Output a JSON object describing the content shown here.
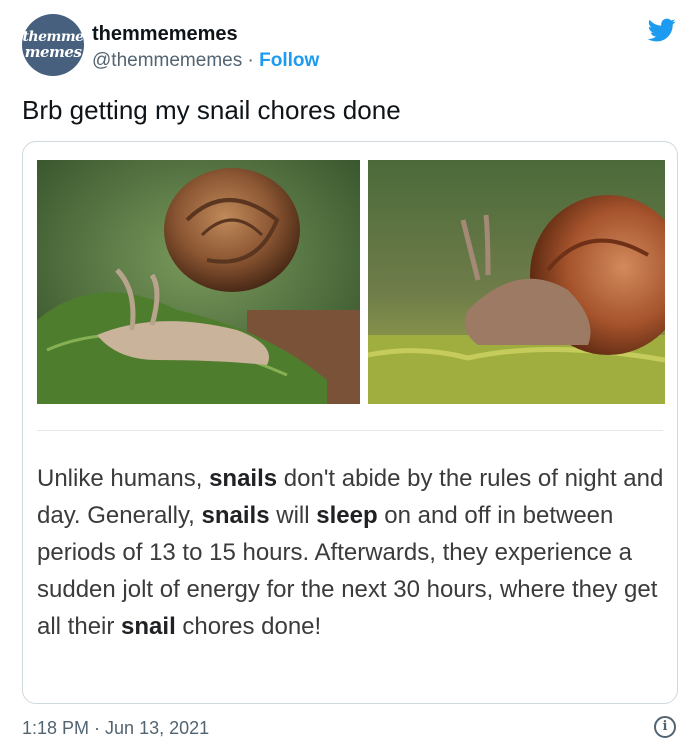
{
  "author": {
    "avatar_line1": "themme",
    "avatar_line2": "memes",
    "display_name": "themmememes",
    "handle": "@themmememes",
    "separator": " · ",
    "follow_label": "Follow"
  },
  "tweet": {
    "text": "Brb getting my snail chores done",
    "caption_parts": [
      "Unlike humans, ",
      "snails",
      " don't abide by the rules of night and day. Generally, ",
      "snails",
      " will ",
      "sleep",
      " on and off in between periods of 13 to 15 hours. Afterwards, they experience a sudden jolt of energy for the next 30 hours, where they get all their ",
      "snail",
      " chores done!"
    ],
    "time": "1:18 PM",
    "date_separator": " · ",
    "date": "Jun 13, 2021"
  },
  "icons": {
    "platform": "twitter-bird-icon",
    "info": "info-icon",
    "info_glyph": "i"
  },
  "colors": {
    "link_blue": "#1d9bf0",
    "avatar_bg": "#47607e",
    "muted_text": "#536471"
  }
}
